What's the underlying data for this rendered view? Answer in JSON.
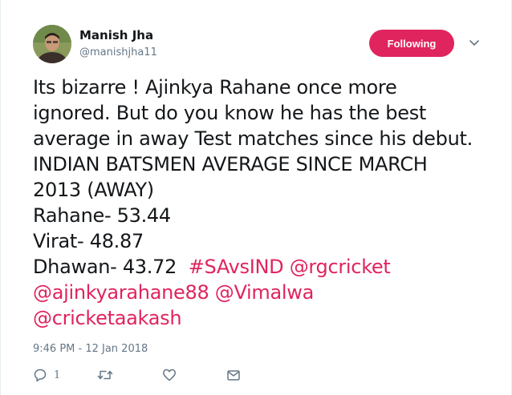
{
  "author": {
    "name": "Manish Jha",
    "handle": "@manishjha11"
  },
  "follow_button": {
    "label": "Following",
    "color": "#e0245e"
  },
  "tweet": {
    "lines": [
      "Its bizarre ! Ajinkya Rahane once more",
      "ignored. But do you know he has the best",
      "average in away Test matches since his debut.",
      "INDIAN BATSMEN AVERAGE SINCE MARCH",
      "2013 (AWAY)",
      "Rahane- 53.44",
      "Virat- 48.87"
    ],
    "line8_text": "Dhawan- 43.72",
    "hashtag": "#SAvsIND",
    "mentions": [
      "@rgcricket",
      "@ajinkyarahane88",
      "@Vimalwa",
      "@cricketaakash"
    ],
    "link_color": "#e0245e"
  },
  "timestamp": "9:46 PM - 12 Jan 2018",
  "actions": {
    "reply_icon": "reply-icon",
    "reply_count": "1",
    "retweet_icon": "retweet-icon",
    "like_icon": "heart-icon",
    "dm_icon": "envelope-icon"
  }
}
